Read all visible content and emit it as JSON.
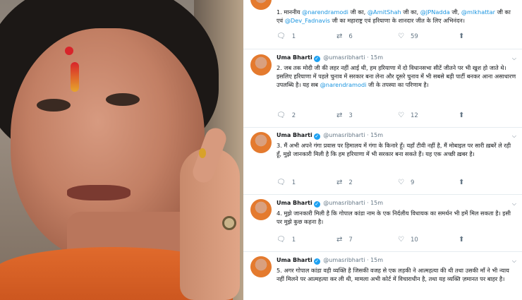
{
  "tweets": [
    {
      "name": "",
      "handle": "",
      "time": "",
      "parts": [
        {
          "t": "1. माननीय "
        },
        {
          "m": "@narendramodi"
        },
        {
          "t": " जी का, "
        },
        {
          "m": "@AmitShah"
        },
        {
          "t": " जी का, "
        },
        {
          "m": "@JPNadda"
        },
        {
          "t": " जी, "
        },
        {
          "m": "@mlkhattar"
        },
        {
          "t": " जी का एवं "
        },
        {
          "m": "@Dev_Fadnavis"
        },
        {
          "t": " जी का महाराष्ट्र एवं हरियाणा के शानदार जीत के लिए अभिनंदन।"
        }
      ],
      "replies": "1",
      "retweets": "6",
      "likes": "59"
    },
    {
      "name": "Uma Bharti",
      "handle": "@umasribharti",
      "time": "15m",
      "parts": [
        {
          "t": "2. जब तक मोदी जी की लहर नहीं आई थी, हम हरियाणा में दो विधानसभा सीटें जीतने पर भी खुश हो जाते थे। इसलिए हरियाणा में पहले चुनाव में सरकार बना लेना और दूसरे चुनाव में भी सबसे बड़ी पार्टी बनकर आना असाधारण उपलब्धि है। यह सब "
        },
        {
          "m": "@narendramodi"
        },
        {
          "t": " जी के तपस्या का परिणाम है।"
        }
      ],
      "replies": "2",
      "retweets": "3",
      "likes": "12"
    },
    {
      "name": "Uma Bharti",
      "handle": "@umasribharti",
      "time": "15m",
      "parts": [
        {
          "t": "3. मैं अभी अपने गंगा प्रवास पर हिमालय में गंगा के किनारे हूँ। यहाँ टीवी नहीं है, मैं मोबाइल पर सारी ख़बरें ले रही हूँ, मुझे जानकारी मिली है कि हम हरियाणा में भी सरकार बना सकते हैं। यह एक अच्छी ख़बर है।"
        }
      ],
      "replies": "1",
      "retweets": "2",
      "likes": "9"
    },
    {
      "name": "Uma Bharti",
      "handle": "@umasribharti",
      "time": "15m",
      "parts": [
        {
          "t": "4. मुझे जानकारी मिली है कि गोपाल कांडा नाम के एक निर्दलीय विधायक का समर्थन भी हमें मिल सकता है। इसी पर मुझे कुछ कहना है।"
        }
      ],
      "replies": "1",
      "retweets": "7",
      "likes": "10"
    },
    {
      "name": "Uma Bharti",
      "handle": "@umasribharti",
      "time": "15m",
      "parts": [
        {
          "t": "5. अगर गोपाल कांडा वही व्यक्ति है जिसकी वजह से एक लड़की ने आत्महत्या की थी तथा उसकी माँ ने भी न्याय नहीं मिलने पर आत्महत्या कर ली थी, मामला अभी कोर्ट में विचाराधीन है, तथा यह व्यक्ति ज़मानत पर बाहर है।"
        }
      ],
      "replies": "",
      "retweets": "",
      "likes": ""
    }
  ],
  "icons": {
    "reply": "reply-icon",
    "retweet": "retweet-icon",
    "like": "heart-icon",
    "share": "share-icon",
    "verified": "verified-badge-icon",
    "more": "chevron-down-icon"
  },
  "colors": {
    "mention": "#1b95e0",
    "verified": "#1da1f2",
    "meta": "#657786"
  }
}
